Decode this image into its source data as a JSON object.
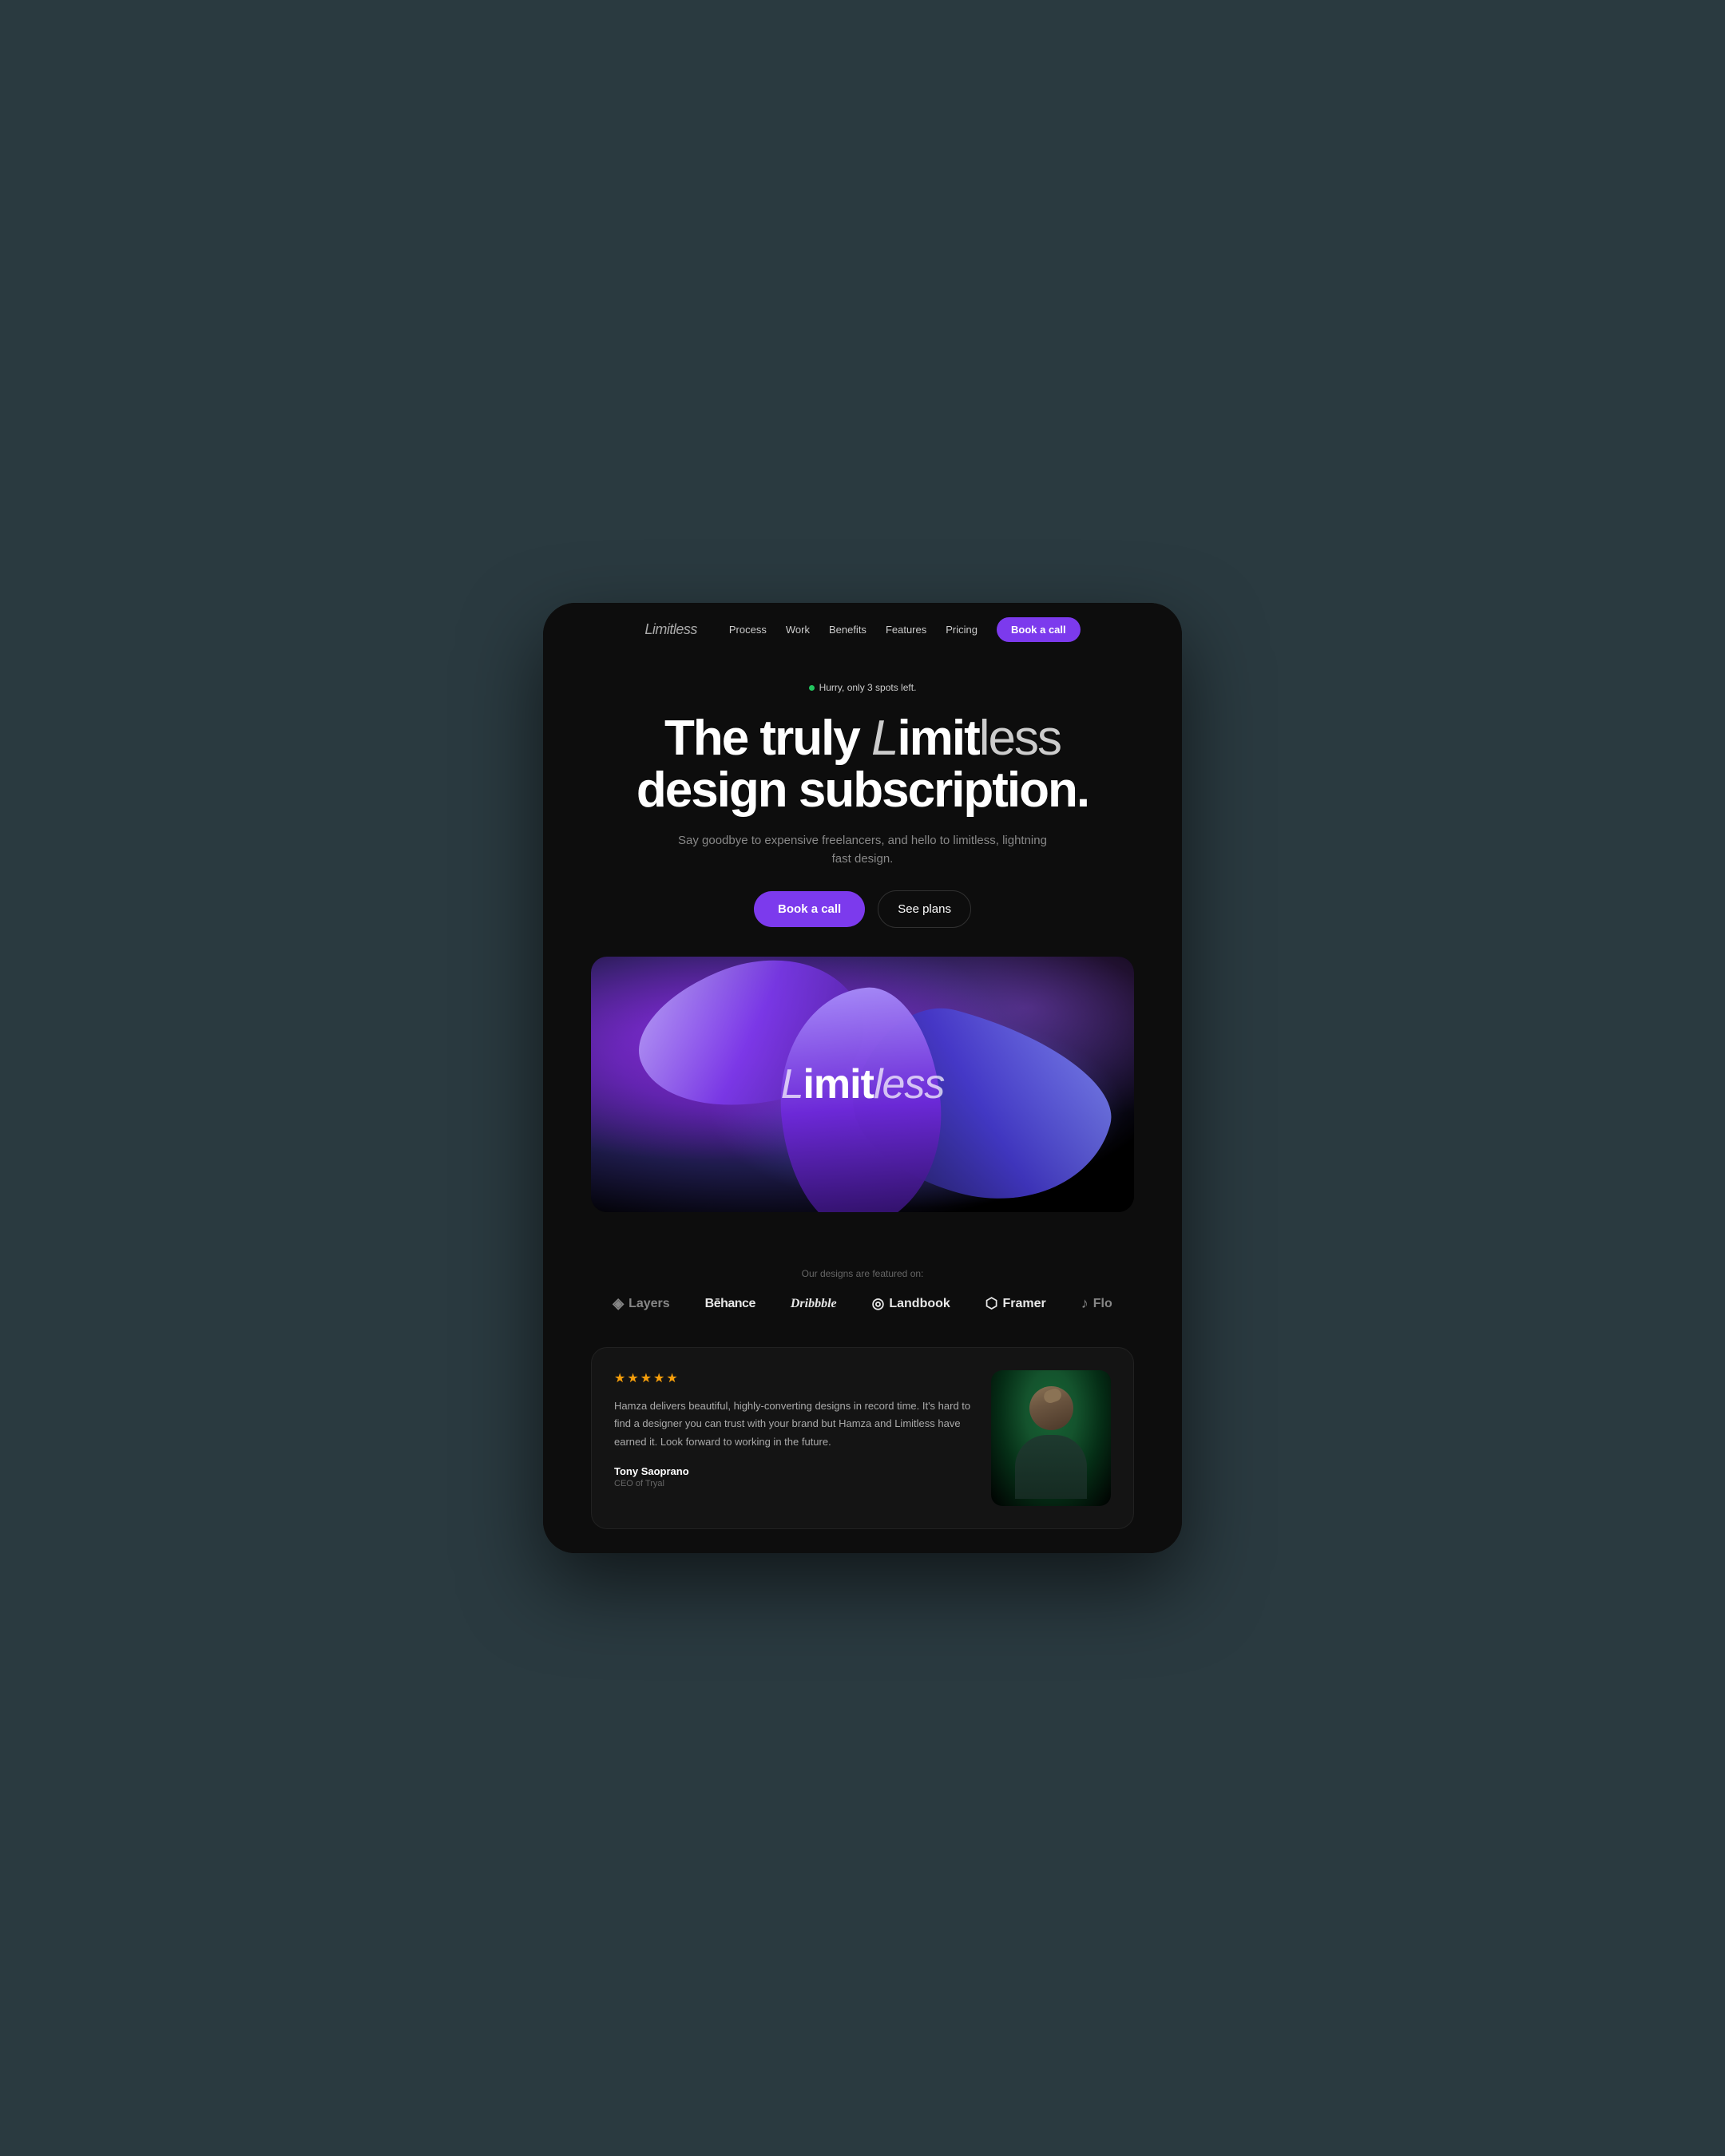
{
  "device": {
    "border_radius": "40px"
  },
  "nav": {
    "logo": {
      "bold": "Limit",
      "italic": "less"
    },
    "links": [
      "Process",
      "Work",
      "Benefits",
      "Features",
      "Pricing"
    ],
    "cta": "Book a call"
  },
  "hero": {
    "urgency": "Hurry, only 3 spots left.",
    "title_line1_plain": "The truly ",
    "title_line1_brand_italic": "L",
    "title_line1_brand_bold": "imit",
    "title_line1_brand_light": "less",
    "title_line2": "design subscription.",
    "subtitle": "Say goodbye to expensive freelancers, and hello to limitless, lightning fast design.",
    "cta_primary": "Book a call",
    "cta_secondary": "See plans"
  },
  "hero_brand": {
    "italic": "L",
    "bold": "imit",
    "light": "less"
  },
  "featured": {
    "label": "Our designs are featured on:",
    "logos": [
      {
        "name": "Layers",
        "class": "layers",
        "icon": "◈"
      },
      {
        "name": "Bēhance",
        "class": "behance",
        "icon": ""
      },
      {
        "name": "Dribbble",
        "class": "dribbble",
        "icon": ""
      },
      {
        "name": "Landbook",
        "class": "landbook",
        "icon": "◎"
      },
      {
        "name": "Framer",
        "class": "framer",
        "icon": "⬡"
      },
      {
        "name": "Flo",
        "class": "flo",
        "icon": "♪"
      }
    ]
  },
  "testimonial": {
    "stars": "★★★★★",
    "text": "Hamza delivers beautiful, highly-converting designs in record time. It's hard to find a designer you can trust with your brand but Hamza and Limitless have earned it. Look forward to working in the future.",
    "author_name": "Tony Saoprano",
    "author_title": "CEO of Tryal"
  }
}
